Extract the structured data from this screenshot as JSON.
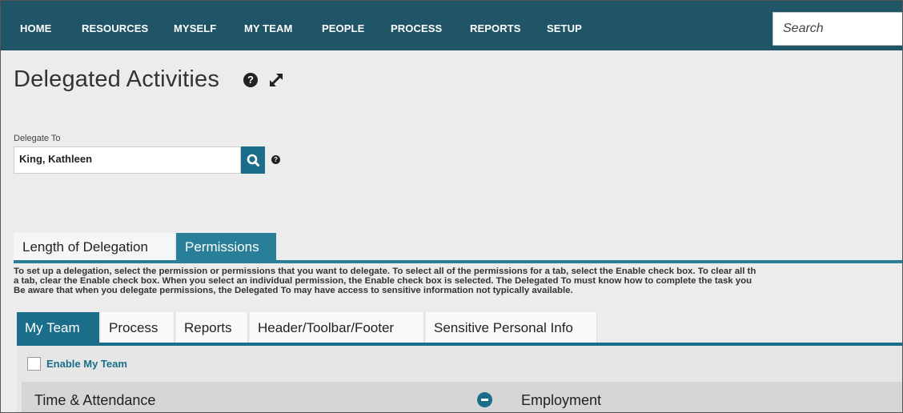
{
  "nav": {
    "items": [
      {
        "label": "HOME"
      },
      {
        "label": "RESOURCES"
      },
      {
        "label": "MYSELF"
      },
      {
        "label": "MY TEAM"
      },
      {
        "label": "PEOPLE"
      },
      {
        "label": "PROCESS"
      },
      {
        "label": "REPORTS"
      },
      {
        "label": "SETUP"
      }
    ],
    "search_placeholder": "Search"
  },
  "page": {
    "title": "Delegated Activities",
    "help_glyph": "?"
  },
  "delegate": {
    "label": "Delegate To",
    "value": "King, Kathleen"
  },
  "main_tabs": [
    {
      "label": "Length of Delegation",
      "active": false
    },
    {
      "label": "Permissions",
      "active": true
    }
  ],
  "instructions": {
    "line1": "To set up a delegation, select the permission or permissions that you want to delegate. To select all of the permissions for a tab, select the Enable check box. To clear all th",
    "line2": "a tab, clear the Enable check box. When you select an individual permission, the Enable check box is selected. The Delegated To must know how to complete the task you",
    "line3": "Be aware that when you delegate permissions, the Delegated To may have access to sensitive information not typically available."
  },
  "sub_tabs": [
    {
      "label": "My Team",
      "active": true
    },
    {
      "label": "Process",
      "active": false
    },
    {
      "label": "Reports",
      "active": false
    },
    {
      "label": "Header/Toolbar/Footer",
      "active": false
    },
    {
      "label": "Sensitive Personal Info",
      "active": false
    }
  ],
  "panel": {
    "enable_label": "Enable My Team",
    "section_left": "Time & Attendance",
    "section_right": "Employment"
  },
  "colors": {
    "nav_bg": "#1f5566",
    "accent": "#1a6e8a",
    "tab_active": "#2a7f98"
  }
}
